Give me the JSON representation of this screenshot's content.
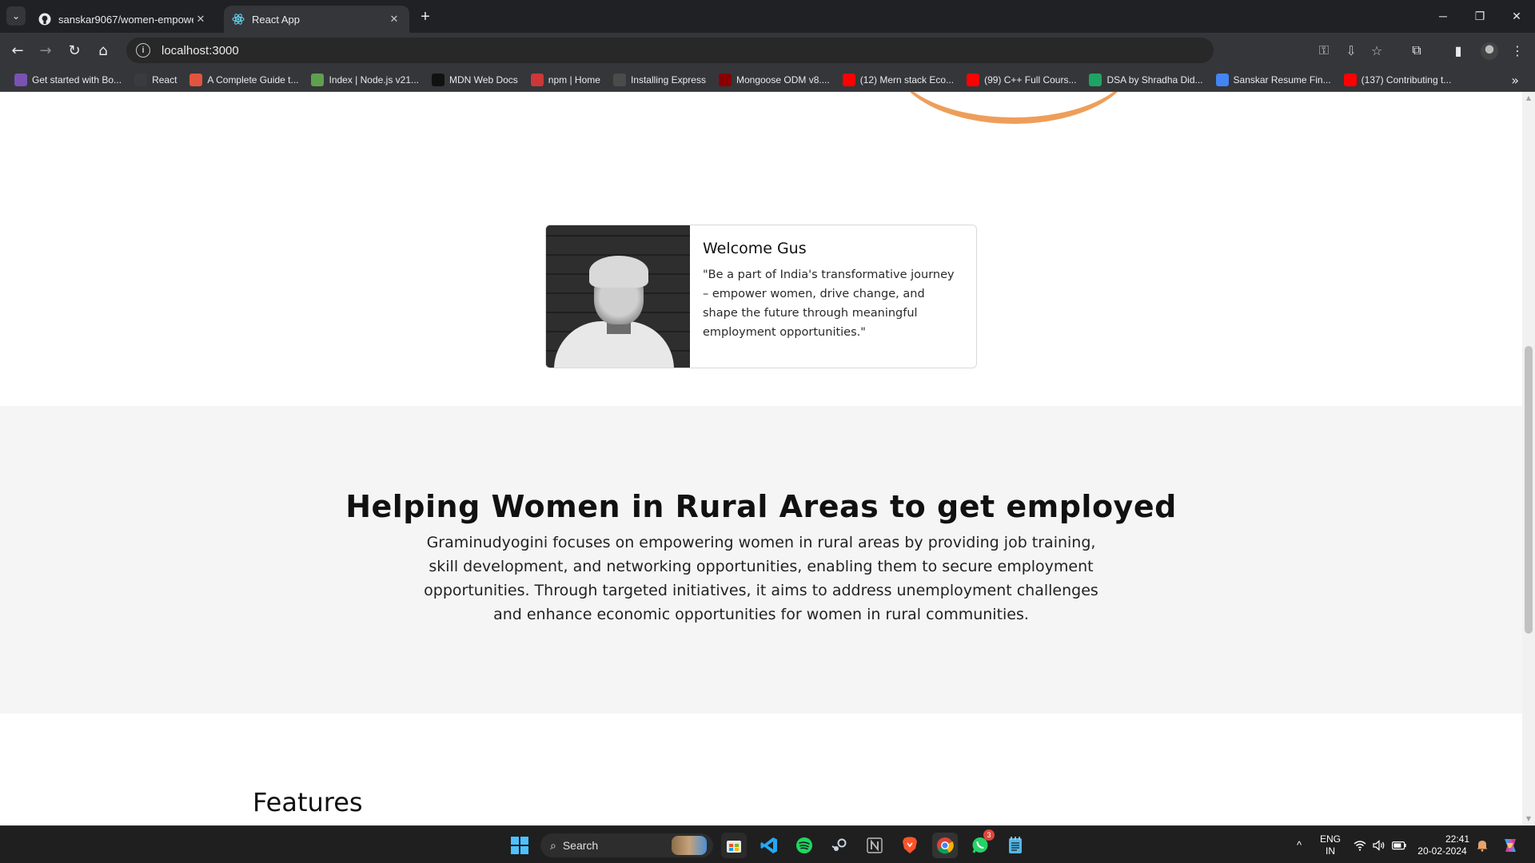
{
  "browser": {
    "tabs": [
      {
        "title": "sanskar9067/women-empowerm",
        "favicon": "github-icon",
        "active": false
      },
      {
        "title": "React App",
        "favicon": "react-icon",
        "active": true
      }
    ],
    "url": "localhost:3000",
    "bookmarks": [
      {
        "label": "Get started with Bo...",
        "icon": "bootstrap-icon",
        "color": "#7952b3"
      },
      {
        "label": "React",
        "icon": "react-icon",
        "color": "#3a3b3f"
      },
      {
        "label": "A Complete Guide t...",
        "icon": "star-burst-icon",
        "color": "#e2553c"
      },
      {
        "label": "Index | Node.js v21...",
        "icon": "nodejs-icon",
        "color": "#5fa04e"
      },
      {
        "label": "MDN Web Docs",
        "icon": "mdn-icon",
        "color": "#111111"
      },
      {
        "label": "npm | Home",
        "icon": "npm-icon",
        "color": "#cb3837"
      },
      {
        "label": "Installing Express",
        "icon": "express-icon",
        "color": "#4b4b4b"
      },
      {
        "label": "Mongoose ODM v8....",
        "icon": "mongoose-icon",
        "color": "#880000"
      },
      {
        "label": "(12) Mern stack Eco...",
        "icon": "youtube-icon",
        "color": "#ff0000"
      },
      {
        "label": "(99) C++ Full Cours...",
        "icon": "youtube-icon",
        "color": "#ff0000"
      },
      {
        "label": "DSA by Shradha Did...",
        "icon": "sheets-icon",
        "color": "#1fa463"
      },
      {
        "label": "Sanskar Resume Fin...",
        "icon": "docs-icon",
        "color": "#4285f4"
      },
      {
        "label": "(137) Contributing t...",
        "icon": "youtube-icon",
        "color": "#ff0000"
      }
    ]
  },
  "page": {
    "welcome_card": {
      "title": "Welcome Gus",
      "quote": "\"Be a part of India's transformative journey – empower women, drive change, and shape the future through meaningful employment opportunities.\""
    },
    "mission": {
      "heading": "Helping Women in Rural Areas to get employed",
      "text": "Graminudyogini focuses on empowering women in rural areas by providing job training, skill development, and networking opportunities, enabling them to secure employment opportunities. Through targeted initiatives, it aims to address unemployment challenges and enhance economic opportunities for women in rural communities."
    },
    "features_heading": "Features",
    "accent_color": "#ee9e5a"
  },
  "taskbar": {
    "search_placeholder": "Search",
    "whatsapp_badge": "3",
    "language": "ENG",
    "region": "IN",
    "time": "22:41",
    "date": "20-02-2024"
  }
}
